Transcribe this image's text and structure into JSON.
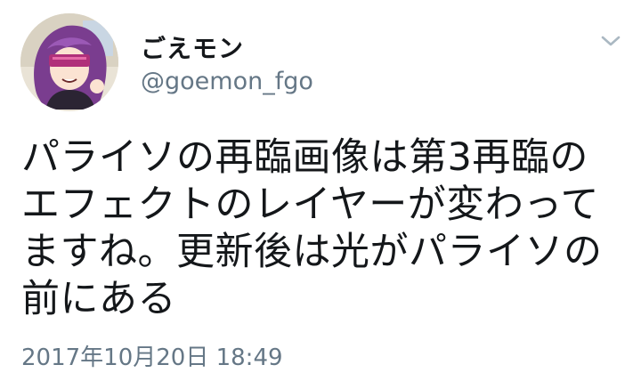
{
  "author": {
    "display_name": "ごえモン",
    "handle": "@goemon_fgo",
    "avatar_icon": "avatar-illustration-icon"
  },
  "menu": {
    "icon": "chevron-down-icon"
  },
  "tweet": {
    "lines": [
      "パライソの再臨画像は第3再臨の",
      "エフェクトのレイヤーが変わって",
      "ますね。更新後は光がパライソの",
      "前にある"
    ],
    "timestamp": "2017年10月20日 18:49"
  },
  "colors": {
    "text_primary": "#14171a",
    "text_secondary": "#657786",
    "chevron": "#aab8c2",
    "background": "#ffffff"
  }
}
